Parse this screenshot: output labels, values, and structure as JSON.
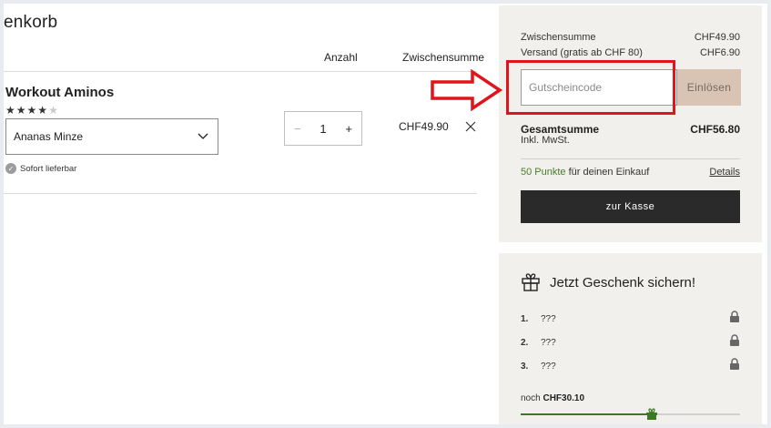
{
  "cart": {
    "title": "enkorb",
    "columns": {
      "quantity": "Anzahl",
      "subtotal": "Zwischensumme"
    },
    "item": {
      "name": "Workout Aminos",
      "rating": 4,
      "rating_max": 5,
      "variant": "Ananas Minze",
      "availability": "Sofort lieferbar",
      "quantity": "1",
      "minus": "−",
      "plus": "+",
      "price": "CHF49.90"
    }
  },
  "summary": {
    "subtotal_label": "Zwischensumme",
    "subtotal_value": "CHF49.90",
    "shipping_label": "Versand (gratis ab CHF 80)",
    "shipping_value": "CHF6.90",
    "coupon_placeholder": "Gutscheincode",
    "redeem_label": "Einlösen",
    "total_label": "Gesamtsumme",
    "total_sub": "Inkl. MwSt.",
    "total_value": "CHF56.80",
    "points_highlight": "50 Punkte",
    "points_text": " für deinen Einkauf",
    "details_label": "Details",
    "checkout_label": "zur Kasse"
  },
  "gift": {
    "title": "Jetzt Geschenk sichern!",
    "items": [
      {
        "num": "1.",
        "label": "???"
      },
      {
        "num": "2.",
        "label": "???"
      },
      {
        "num": "3.",
        "label": "???"
      }
    ],
    "remaining_prefix": "noch ",
    "remaining_value": "CHF30.10",
    "progress": 0.62
  },
  "colors": {
    "annotation": "#e0141c",
    "checkout_bg": "#2a2a2a",
    "redeem_bg": "#d9c3b2",
    "points_green": "#4a7d2a",
    "progress_green": "#3a7a22"
  },
  "icons": {
    "chevron": "chevron-down-icon",
    "remove": "close-icon",
    "check": "check-circle-icon",
    "gift": "gift-icon",
    "lock": "lock-icon",
    "arrow": "arrow-right-icon"
  }
}
